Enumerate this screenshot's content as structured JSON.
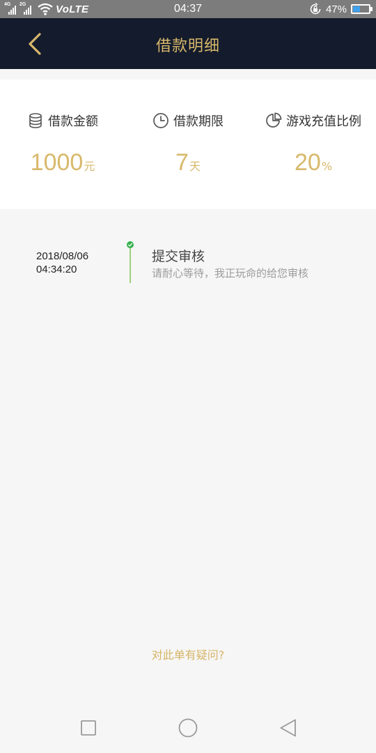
{
  "status_bar": {
    "net1": "4G",
    "net2": "2G",
    "volte": "VoLTE",
    "time": "04:37",
    "battery_percent": "47%",
    "battery_level": 0.47,
    "battery_color": "#3ea2ee"
  },
  "nav": {
    "title": "借款明细",
    "back_icon": "chevron-left-icon",
    "accent": "#d8b86b",
    "background": "#141b2c"
  },
  "summary": {
    "items": [
      {
        "icon": "coin-stack-icon",
        "label": "借款金额",
        "value": "1000",
        "unit": "元"
      },
      {
        "icon": "clock-icon",
        "label": "借款期限",
        "value": "7",
        "unit": "天"
      },
      {
        "icon": "pie-chart-icon",
        "label": "游戏充值比例",
        "value": "20",
        "unit": "%"
      }
    ]
  },
  "timeline": {
    "entries": [
      {
        "date": "2018/08/06",
        "time": "04:34:20",
        "title": "提交审核",
        "description": "请耐心等待，我正玩命的给您审核",
        "status_color": "#35b24a"
      }
    ]
  },
  "footer": {
    "question_link": "对此单有疑问?"
  },
  "system_nav": {
    "buttons": [
      "recents-square-icon",
      "home-circle-icon",
      "back-triangle-icon"
    ]
  }
}
